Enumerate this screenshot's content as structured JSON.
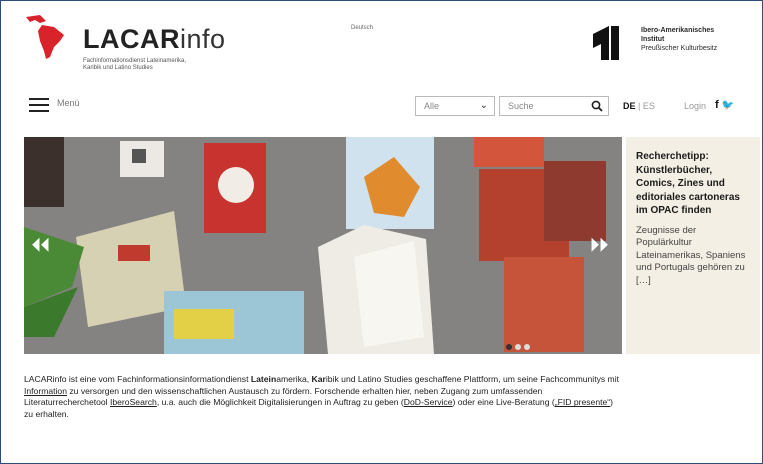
{
  "header": {
    "logo_bold": "LACAR",
    "logo_light": "info",
    "logo_subtitle_line1": "Fachinformationsdienst Lateinamerika,",
    "logo_subtitle_line2": "Karibik und Latino Studies",
    "language_note": "Deutsch",
    "partner_line1": "Ibero-Amerikanisches",
    "partner_line2": "Institut",
    "partner_line3": "Preußischer Kulturbesitz"
  },
  "nav": {
    "menu_label": "Menü",
    "search_scope": "Alle",
    "search_placeholder": "Suche",
    "lang_active": "DE",
    "lang_separator": "|",
    "lang_other": "ES",
    "login_label": "Login",
    "facebook_glyph": "f",
    "twitter_glyph": "🐦"
  },
  "slider": {
    "prev_glyph": "⏴⏴",
    "next_glyph": "⏵⏵",
    "dots": 3,
    "active_dot": 1
  },
  "teaser": {
    "title": "Recherchetipp: Künstlerbücher, Comics, Zines und editoriales cartoneras im OPAC finden",
    "text": "Zeugnisse der Populärkultur Lateinamerikas, Spaniens und Portugals gehören zu […]"
  },
  "intro": {
    "part1": "LACARinfo ist eine vom Fachinformationsinformationdienst ",
    "lat_bold": "Latein",
    "lat_rest": "amerika, ",
    "kar_bold": "Kar",
    "kar_rest": "ibik und Latino Studies geschaffene Plattform, um seine Fachcommunitys mit ",
    "link_information": "Information",
    "part2": " zu versorgen und den wissenschaftlichen Austausch zu fördern. Forschende erhalten hier, neben Zugang zum umfassenden Literaturrecherchetool ",
    "link_iberosearch": "IberoSearch",
    "part3": ", u.a. auch die Möglichkeit Digitalisierungen in Auftrag zu geben (",
    "link_dod": "DoD-Service",
    "part4": ") oder eine Live-Beratung (",
    "link_fid": "„FID presente“",
    "part5": ") zu erhalten."
  },
  "colors": {
    "logo_red": "#d8232a",
    "teaser_bg": "#f4efe4",
    "frame": "#2b4f7a"
  }
}
